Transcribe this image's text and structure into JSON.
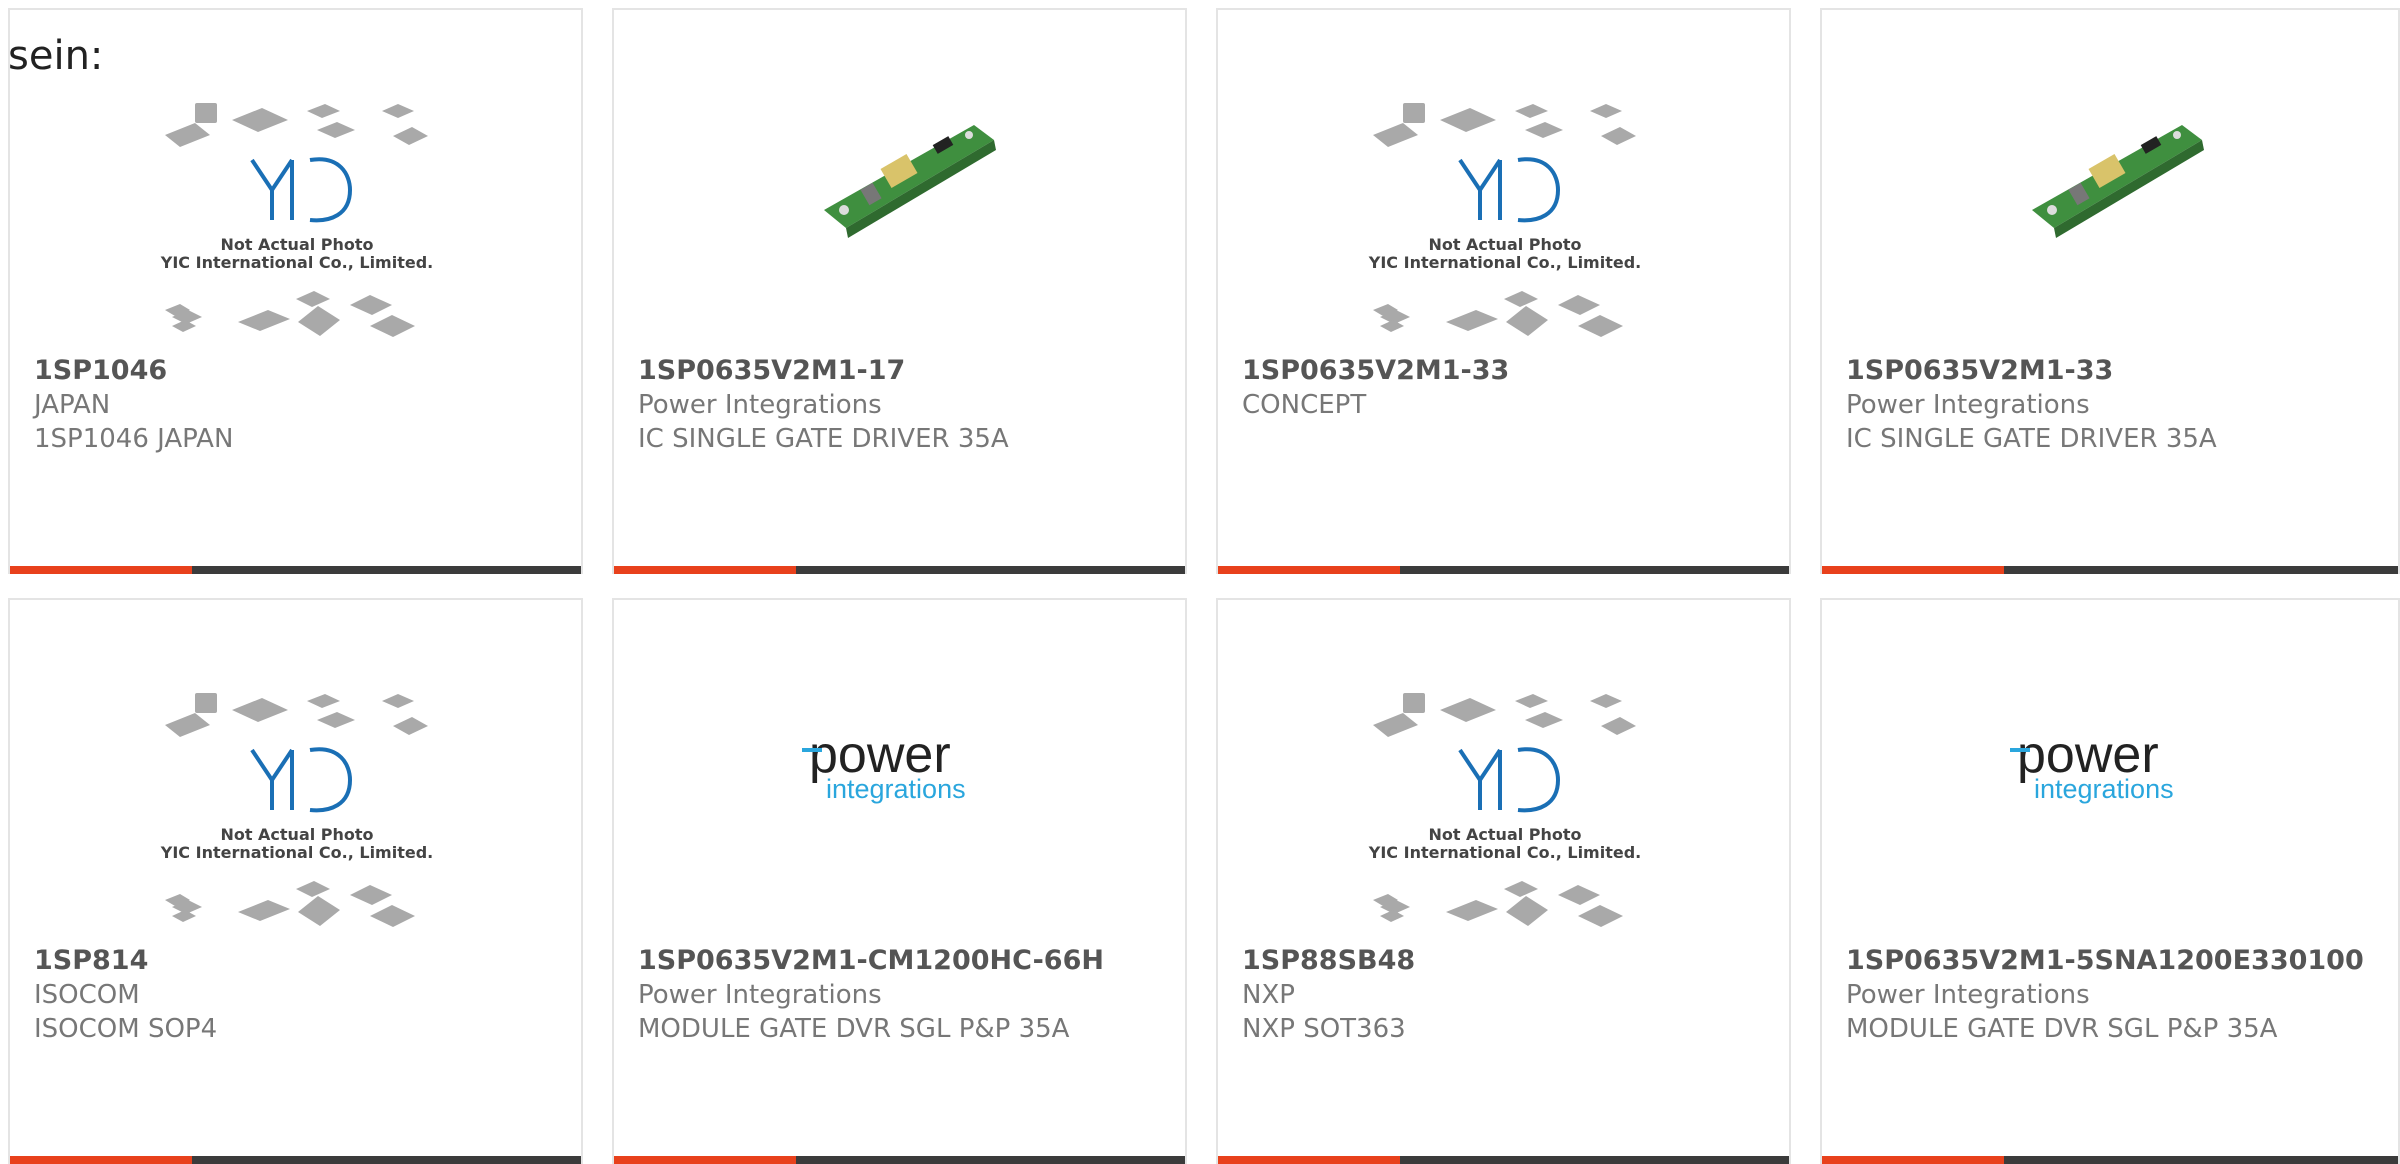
{
  "intro_text": "sein:",
  "placeholder_caption": [
    "Not Actual Photo",
    "YIC International Co., Limited."
  ],
  "logo_text": {
    "power": "power",
    "integrations": "integrations"
  },
  "colors": {
    "accent": "#e8411c",
    "bar": "#3b3b3b",
    "yic_blue": "#1a6fb5",
    "pi_blue": "#2aa6dd"
  },
  "products": [
    {
      "part_number": "1SP1046",
      "manufacturer": "JAPAN",
      "description": "1SP1046 JAPAN",
      "image": "yic-placeholder"
    },
    {
      "part_number": "1SP0635V2M1-17",
      "manufacturer": "Power Integrations",
      "description": "IC SINGLE GATE DRIVER 35A",
      "image": "pcb-board"
    },
    {
      "part_number": "1SP0635V2M1-33",
      "manufacturer": "CONCEPT",
      "description": "",
      "image": "yic-placeholder"
    },
    {
      "part_number": "1SP0635V2M1-33",
      "manufacturer": "Power Integrations",
      "description": "IC SINGLE GATE DRIVER 35A",
      "image": "pcb-board"
    },
    {
      "part_number": "1SP814",
      "manufacturer": "ISOCOM",
      "description": "ISOCOM SOP4",
      "image": "yic-placeholder"
    },
    {
      "part_number": "1SP0635V2M1-CM1200HC-66H",
      "manufacturer": "Power Integrations",
      "description": "MODULE GATE DVR SGL P&P 35A",
      "image": "power-integrations-logo"
    },
    {
      "part_number": "1SP88SB48",
      "manufacturer": "NXP",
      "description": "NXP SOT363",
      "image": "yic-placeholder"
    },
    {
      "part_number": "1SP0635V2M1-5SNA1200E330100",
      "manufacturer": "Power Integrations",
      "description": "MODULE GATE DVR SGL P&P 35A",
      "image": "power-integrations-logo"
    }
  ]
}
